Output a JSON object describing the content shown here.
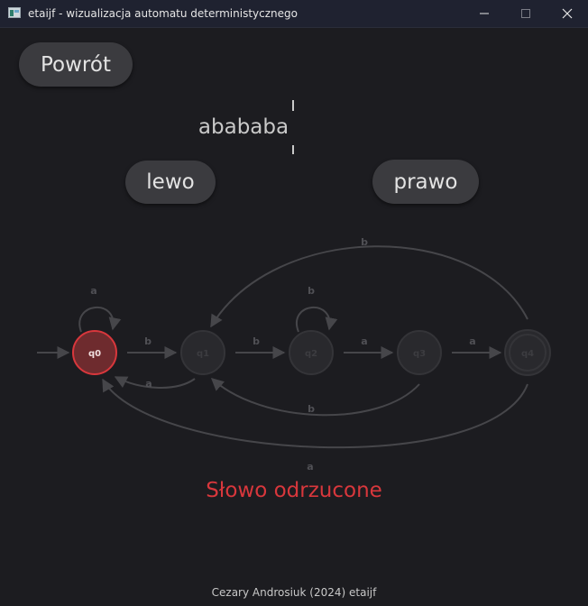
{
  "window": {
    "title": "etaijf - wizualizacja automatu deterministycznego"
  },
  "controls": {
    "back_label": "Powrót",
    "left_label": "lewo",
    "right_label": "prawo"
  },
  "input_word": "abababa",
  "automaton": {
    "states": [
      {
        "id": "q0",
        "active": true,
        "accepting": false,
        "initial": true
      },
      {
        "id": "q1",
        "active": false,
        "accepting": false,
        "initial": false
      },
      {
        "id": "q2",
        "active": false,
        "accepting": false,
        "initial": false
      },
      {
        "id": "q3",
        "active": false,
        "accepting": false,
        "initial": false
      },
      {
        "id": "q4",
        "active": false,
        "accepting": true,
        "initial": false
      }
    ],
    "transitions": [
      {
        "from": "q0",
        "to": "q0",
        "symbol": "a"
      },
      {
        "from": "q0",
        "to": "q1",
        "symbol": "b"
      },
      {
        "from": "q1",
        "to": "q2",
        "symbol": "b"
      },
      {
        "from": "q1",
        "to": "q0",
        "symbol": "a"
      },
      {
        "from": "q2",
        "to": "q2",
        "symbol": "b"
      },
      {
        "from": "q2",
        "to": "q3",
        "symbol": "a"
      },
      {
        "from": "q3",
        "to": "q4",
        "symbol": "a"
      },
      {
        "from": "q3",
        "to": "q1",
        "symbol": "b"
      },
      {
        "from": "q4",
        "to": "q1",
        "symbol": "b"
      },
      {
        "from": "q4",
        "to": "q0",
        "symbol": "a"
      }
    ]
  },
  "result_text": "Słowo odrzucone",
  "footer_text": "Cezary Androsiuk (2024) etaijf",
  "colors": {
    "background": "#1c1c20",
    "active_state_fill": "#6e2b2e",
    "active_state_border": "#d8373c",
    "inactive_state": "#303034",
    "result": "#d8373c"
  }
}
